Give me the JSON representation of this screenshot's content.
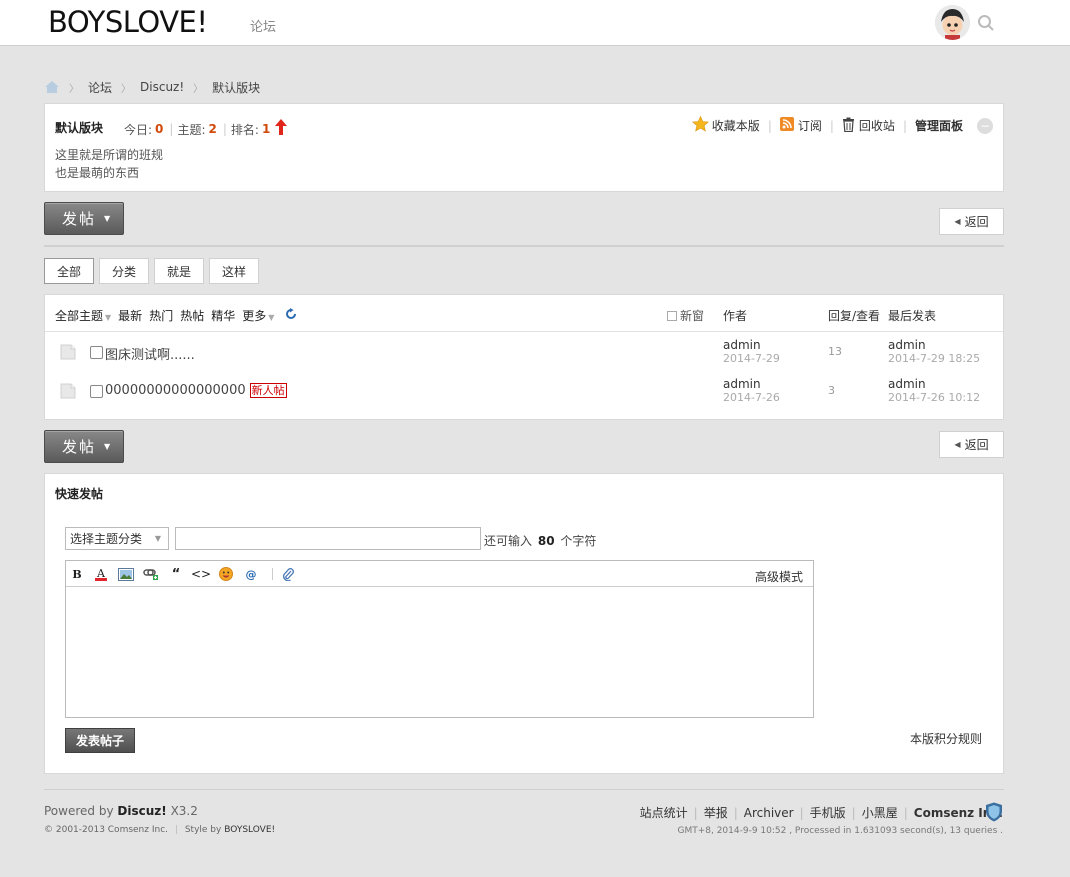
{
  "header": {
    "logo": "BOYSLOVE!",
    "nav_forum": "论坛"
  },
  "breadcrumb": {
    "items": [
      "论坛",
      "Discuz!",
      "默认版块"
    ]
  },
  "forum_info": {
    "title": "默认版块",
    "today_label": "今日:",
    "today_value": "0",
    "threads_label": "主题:",
    "threads_value": "2",
    "rank_label": "排名:",
    "rank_value": "1",
    "description_lines": [
      "这里就是所谓的班规",
      "也是最萌的东西"
    ],
    "actions": {
      "favorite": "收藏本版",
      "subscribe": "订阅",
      "recycle": "回收站",
      "manage": "管理面板"
    }
  },
  "buttons": {
    "post": "发帖",
    "back": "返回",
    "submit": "发表帖子"
  },
  "tabs": [
    "全部",
    "分类",
    "就是",
    "这样"
  ],
  "thread_list": {
    "filters": [
      "全部主题",
      "最新",
      "热门",
      "热帖",
      "精华",
      "更多"
    ],
    "new_window": "新窗",
    "col_author": "作者",
    "col_replies": "回复/查看",
    "col_last": "最后发表",
    "rows": [
      {
        "title": "图床测试啊......",
        "badge": "",
        "author": "admin",
        "author_date": "2014-7-29",
        "count": "13",
        "last_user": "admin",
        "last_time": "2014-7-29 18:25"
      },
      {
        "title": "00000000000000000",
        "badge": "新人帖",
        "author": "admin",
        "author_date": "2014-7-26",
        "count": "3",
        "last_user": "admin",
        "last_time": "2014-7-26 10:12"
      }
    ]
  },
  "quick_post": {
    "title": "快速发帖",
    "type_select": "选择主题分类",
    "char_hint_before": "还可输入",
    "char_hint_count": "80",
    "char_hint_after": "个字符",
    "advanced_mode": "高级模式",
    "credit_rules": "本版积分规则"
  },
  "footer": {
    "powered_prefix": "Powered by",
    "powered_brand": "Discuz!",
    "powered_version": "X3.2",
    "copyright": "© 2001-2013 Comsenz Inc.",
    "style_prefix": "Style by",
    "style_brand": "BOYSLOVE!",
    "links": [
      "站点统计",
      "举报",
      "Archiver",
      "手机版",
      "小黑屋",
      "Comsenz Inc."
    ],
    "gmt": "GMT+8, 2014-9-9 10:52 , Processed in 1.631093 second(s), 13 queries ."
  },
  "colors": {
    "accent_red": "#d14a0b",
    "badge_red": "#cc0000",
    "button_gray": "#5a5a5a"
  }
}
